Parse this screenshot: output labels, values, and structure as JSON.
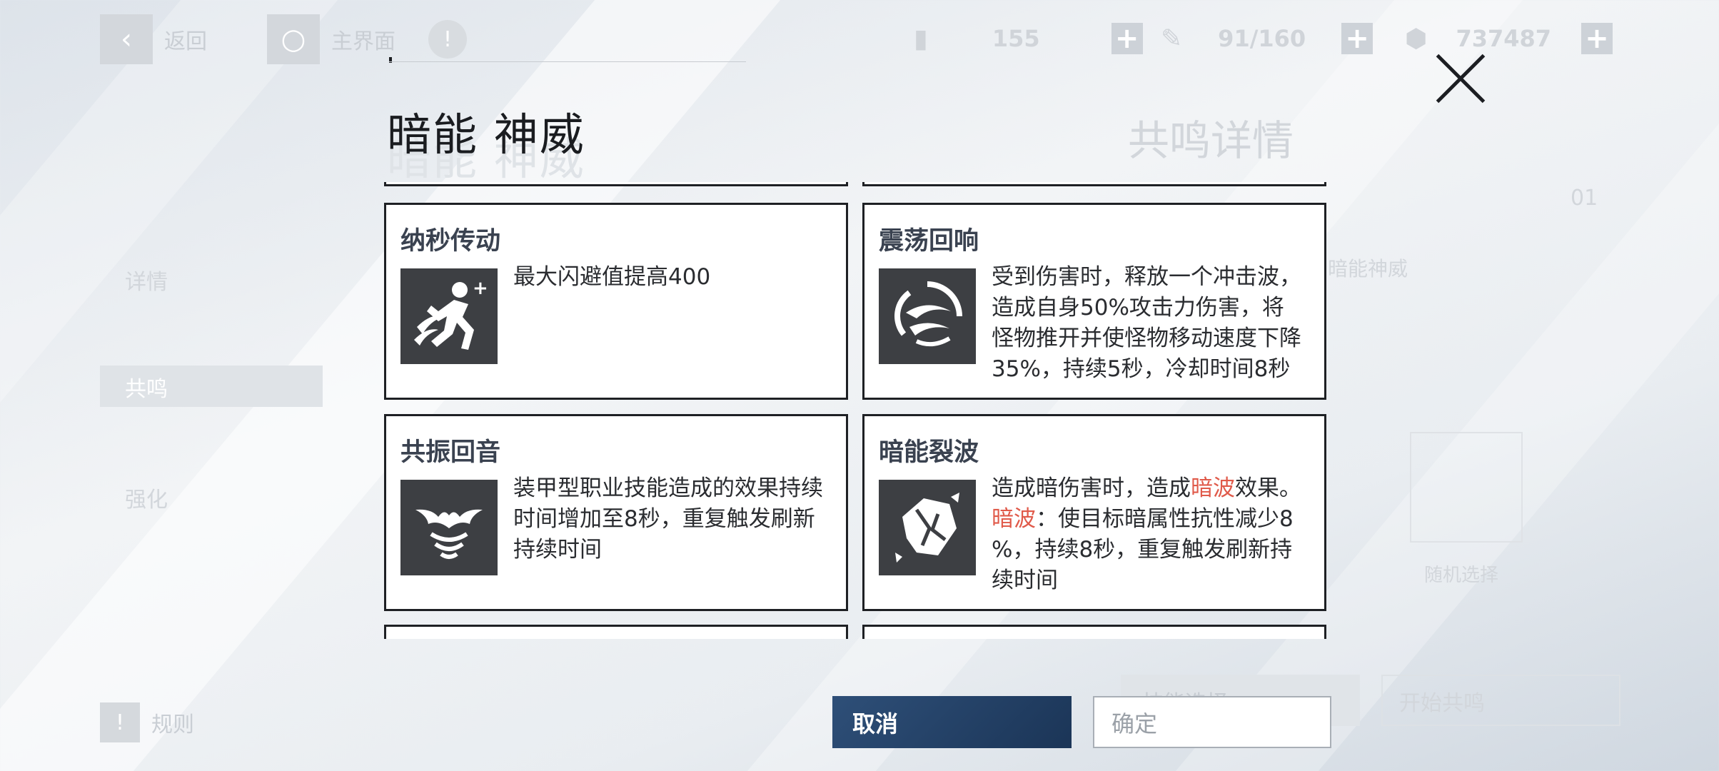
{
  "top_bar": {
    "back_label": "返回",
    "home_label": "主界面",
    "resource_1": "155",
    "resource_2": "91/160",
    "resource_3": "737487"
  },
  "background": {
    "section_title": "共鸣详情",
    "slot_number": "01",
    "left_menu": [
      "详情",
      "共鸣",
      "强化"
    ],
    "rules_label": "规则",
    "bg_button_1": "技能选择",
    "bg_button_2": "开始共鸣",
    "bg_caption_1": "暗能神威",
    "bg_caption_2": "随机选择"
  },
  "modal": {
    "title": "暗能 神威",
    "cards": [
      {
        "name": "纳秒传动",
        "icon": "dodge-runner-icon",
        "desc_lines": [
          "最大闪避值提高400"
        ]
      },
      {
        "name": "震荡回响",
        "icon": "shockwave-icon",
        "desc_lines": [
          "受到伤害时，释放一个冲击波，",
          "造成自身50%攻击力伤害，将",
          "怪物推开并使怪物移动速度下降",
          "35%，持续5秒，冷却时间8秒"
        ]
      },
      {
        "name": "共振回音",
        "icon": "bat-echo-icon",
        "desc_lines": [
          "装甲型职业技能造成的效果持续",
          "时间增加至8秒，重复触发刷新",
          "持续时间"
        ]
      },
      {
        "name": "暗能裂波",
        "icon": "shattered-rock-icon",
        "desc": {
          "l1_a": "造成暗伤害时，造成",
          "l1_hl": "暗波",
          "l1_b": "效果。",
          "l2_hl": "暗波",
          "l2_a": "：使目标暗属性抗性减少8",
          "l3": "%，持续8秒，重复触发刷新持",
          "l4": "续时间"
        }
      }
    ],
    "cancel_label": "取消",
    "confirm_label": "确定"
  },
  "colors": {
    "highlight": "#e05a4a",
    "cancel_bg": "#1b3557",
    "icon_bg": "#3d3f43"
  }
}
